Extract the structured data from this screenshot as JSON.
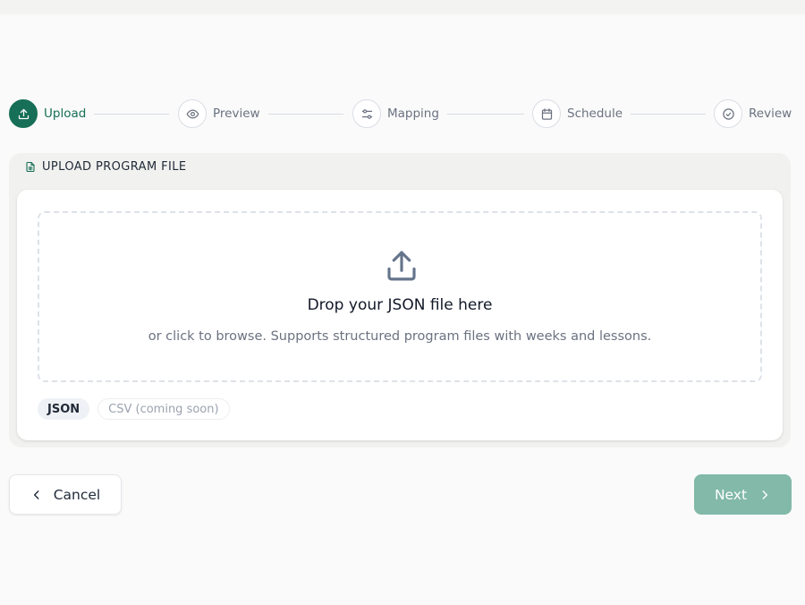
{
  "stepper": {
    "steps": [
      {
        "label": "Upload",
        "icon": "upload-icon",
        "state": "active"
      },
      {
        "label": "Preview",
        "icon": "eye-icon",
        "state": "pending"
      },
      {
        "label": "Mapping",
        "icon": "sliders-icon",
        "state": "pending"
      },
      {
        "label": "Schedule",
        "icon": "calendar-icon",
        "state": "pending"
      },
      {
        "label": "Review",
        "icon": "check-circle-icon",
        "state": "pending"
      }
    ]
  },
  "upload_panel": {
    "title": "UPLOAD PROGRAM FILE",
    "title_icon": "file-spreadsheet-icon",
    "dropzone": {
      "icon": "upload-icon",
      "title": "Drop your JSON file here",
      "subtitle": "or click to browse. Supports structured program files with weeks and lessons."
    },
    "formats": [
      {
        "label": "JSON",
        "selected": true
      },
      {
        "label": "CSV (coming soon)",
        "selected": false
      }
    ]
  },
  "actions": {
    "cancel_label": "Cancel",
    "next_label": "Next",
    "next_enabled": false
  },
  "colors": {
    "accent": "#166f56",
    "accent_disabled": "#82b9a9",
    "background": "#fafafa"
  }
}
